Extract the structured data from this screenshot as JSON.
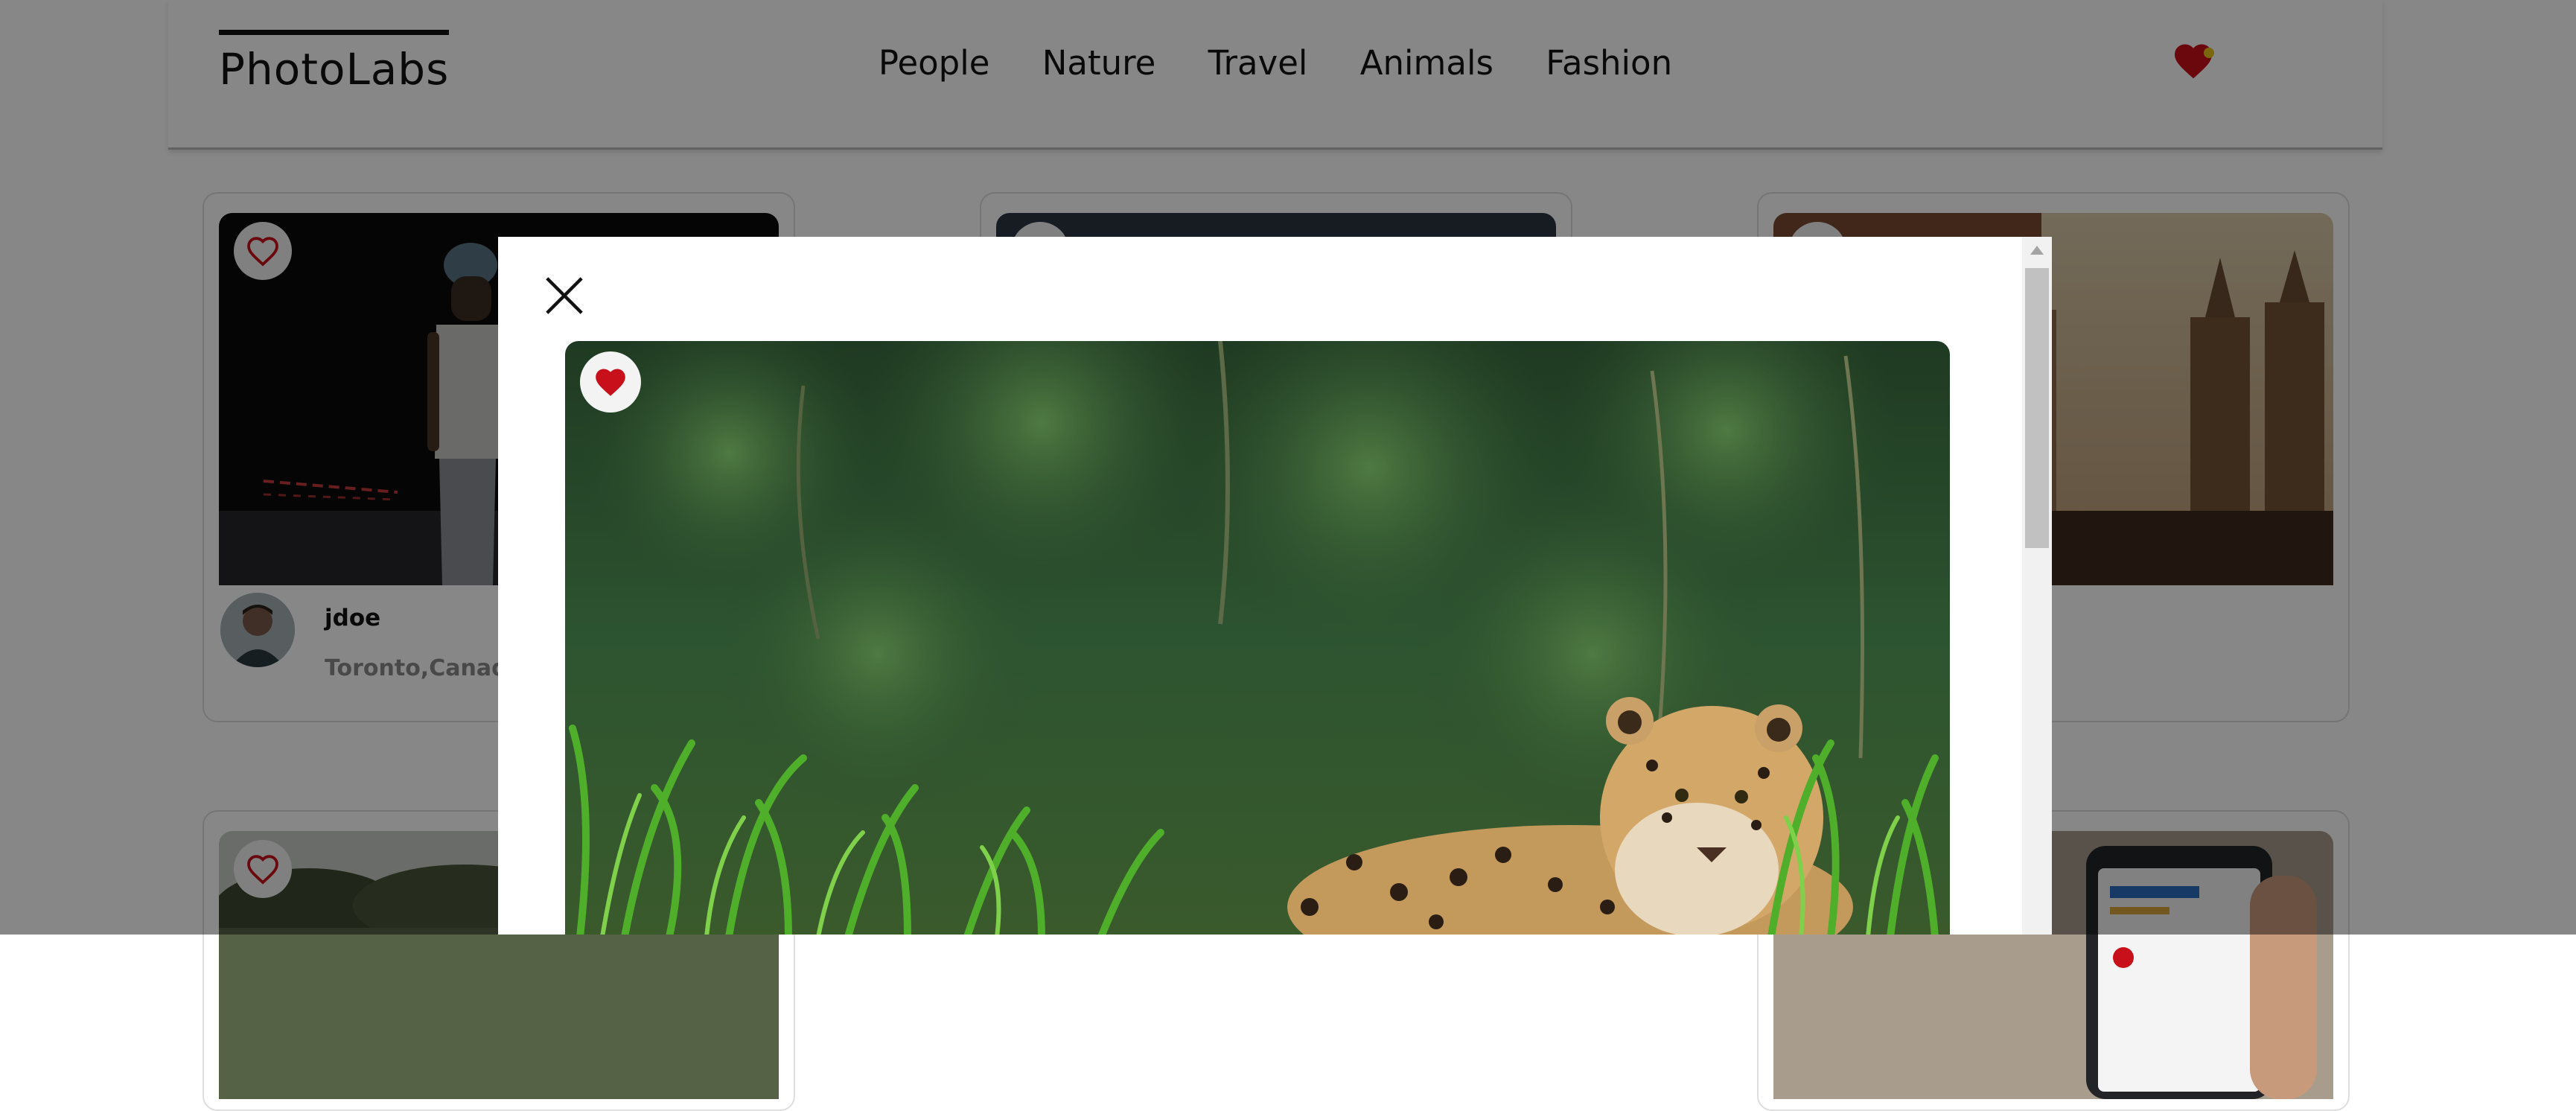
{
  "app": {
    "logo": "PhotoLabs"
  },
  "topics": [
    "People",
    "Nature",
    "Travel",
    "Animals",
    "Fashion"
  ],
  "nav": {
    "fav_icon": "heart-icon",
    "has_favourites": true
  },
  "grid": {
    "cards": [
      {
        "username": "jdoe",
        "location": "Toronto,Canada",
        "favourited": false
      },
      {
        "favourited": false
      },
      {
        "favourited": false
      },
      {
        "favourited": false
      },
      {
        "favourited": false
      },
      {
        "favourited": false
      }
    ]
  },
  "modal": {
    "close_icon": "close-icon",
    "photo_favourited": true,
    "photo_subject": "jaguar"
  },
  "colors": {
    "accent_red": "#c8101a",
    "overlay": "rgba(0,0,0,0.47)",
    "favourite_dot": "#e8c21c"
  }
}
